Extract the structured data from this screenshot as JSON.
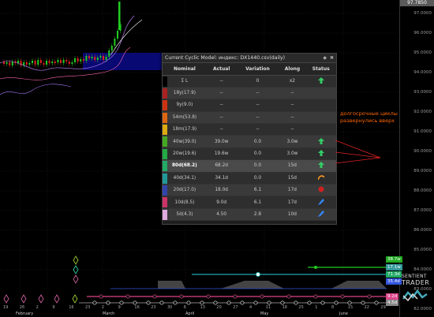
{
  "current_price": "97.7850",
  "price_axis": {
    "labels": [
      "97.0000",
      "96.0000",
      "95.0000",
      "94.0000",
      "93.0000",
      "92.0000",
      "91.0000",
      "90.0000",
      "89.0000",
      "88.0000",
      "87.0000",
      "86.0000",
      "85.0000",
      "84.0000",
      "83.0000",
      "82.0000"
    ]
  },
  "date_axis": {
    "days": [
      "19",
      "26",
      "2",
      "9",
      "16",
      "23",
      "2",
      "9",
      "16",
      "23",
      "30",
      "6",
      "13",
      "20",
      "27",
      "4",
      "11",
      "18",
      "25",
      "1",
      "8",
      "15",
      "22",
      "29"
    ],
    "months": [
      "February",
      "March",
      "April",
      "May",
      "June"
    ]
  },
  "cycle_tags": [
    {
      "label": "38.7w",
      "color": "#22aa22"
    },
    {
      "label": "17.1w",
      "color": "#339999"
    },
    {
      "label": "71.3d",
      "color": "#22aa66"
    },
    {
      "label": "35.4d",
      "color": "#3355dd"
    },
    {
      "label": "9.2d",
      "color": "#dd4488"
    },
    {
      "label": "4.5d",
      "color": "#888888"
    }
  ],
  "panel": {
    "title": "Current Cyclic Model: индекс: DX1440.csv(daily)",
    "ctrl_pin": "◆",
    "ctrl_close": "✖",
    "headers": {
      "nominal": "Nominal",
      "actual": "Actual",
      "variation": "Variation",
      "along": "Along",
      "status": "Status"
    },
    "rows": [
      {
        "nominal": "Σ L",
        "actual": "--",
        "variation": "0",
        "along": "x2",
        "status": "arrow-up",
        "color": "#000000",
        "cls": ""
      },
      {
        "nominal": "18y(17.9)",
        "actual": "--",
        "variation": "--",
        "along": "--",
        "status": "",
        "color": "#aa2222",
        "cls": ""
      },
      {
        "nominal": "9y(9.0)",
        "actual": "--",
        "variation": "--",
        "along": "--",
        "status": "",
        "color": "#cc3311",
        "cls": ""
      },
      {
        "nominal": "54m(53.8)",
        "actual": "--",
        "variation": "--",
        "along": "--",
        "status": "",
        "color": "#dd6611",
        "cls": ""
      },
      {
        "nominal": "18m(17.9)",
        "actual": "--",
        "variation": "--",
        "along": "--",
        "status": "",
        "color": "#ddaa11",
        "cls": ""
      },
      {
        "nominal": "40w(39.0)",
        "actual": "39.0w",
        "variation": "0.0",
        "along": "3.0w",
        "status": "arrow-up",
        "color": "#44aa22",
        "cls": "green"
      },
      {
        "nominal": "20w(19.6)",
        "actual": "19.6w",
        "variation": "0.0",
        "along": "3.0w",
        "status": "arrow-up",
        "color": "#22aa44",
        "cls": "green"
      },
      {
        "nominal": "80d(68.2)",
        "actual": "68.2d",
        "variation": "0.0",
        "along": "15d",
        "status": "arrow-up",
        "color": "#22aa66",
        "cls": "green"
      },
      {
        "nominal": "40d(34.1)",
        "actual": "34.1d",
        "variation": "0.0",
        "along": "15d",
        "status": "curve",
        "color": "#229999",
        "cls": "green"
      },
      {
        "nominal": "20d(17.0)",
        "actual": "18.0d",
        "variation": "6.1",
        "along": "17d",
        "status": "dot-red",
        "color": "#3344aa",
        "cls": "red"
      },
      {
        "nominal": "10d(8.5)",
        "actual": "9.0d",
        "variation": "6.1",
        "along": "17d",
        "status": "pen-blue",
        "color": "#cc3366",
        "cls": "red"
      },
      {
        "nominal": "5d(4.3)",
        "actual": "4.50",
        "variation": "2.8",
        "along": "10d",
        "status": "pen-blue",
        "color": "#ddaadd",
        "cls": "red"
      }
    ]
  },
  "annotation": "долгосрочные циклы развернулись вверх",
  "logo": {
    "line1": "SENTIENT",
    "line2": "TRADER"
  }
}
